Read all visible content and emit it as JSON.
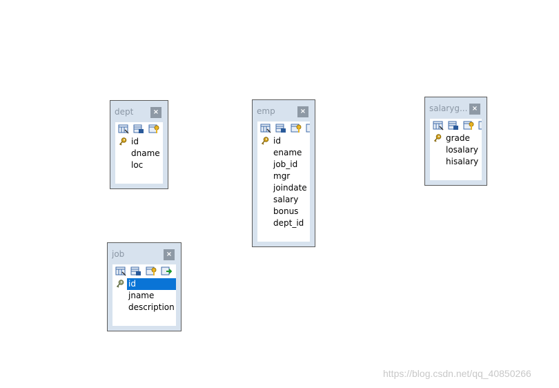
{
  "tables": {
    "dept": {
      "title": "dept",
      "close_label": "×",
      "fields": [
        "id",
        "dname",
        "loc"
      ]
    },
    "emp": {
      "title": "emp",
      "close_label": "×",
      "fields": [
        "id",
        "ename",
        "job_id",
        "mgr",
        "joindate",
        "salary",
        "bonus",
        "dept_id"
      ]
    },
    "salarygrade": {
      "title": "salaryg...",
      "close_label": "×",
      "fields": [
        "grade",
        "losalary",
        "hisalary"
      ]
    },
    "job": {
      "title": "job",
      "close_label": "×",
      "fields": [
        "id",
        "jname",
        "description"
      ],
      "selected_field": "id"
    }
  },
  "toolbar_icons": [
    "design-table-icon",
    "view-data-icon",
    "keys-icon",
    "add-field-icon"
  ],
  "primary_key_icon": "key-icon",
  "colors": {
    "selection": "#0a74d6",
    "key_gold": "#d4a21a",
    "frame": "#d7e2ee"
  },
  "watermark": "https://blog.csdn.net/qq_40850266"
}
